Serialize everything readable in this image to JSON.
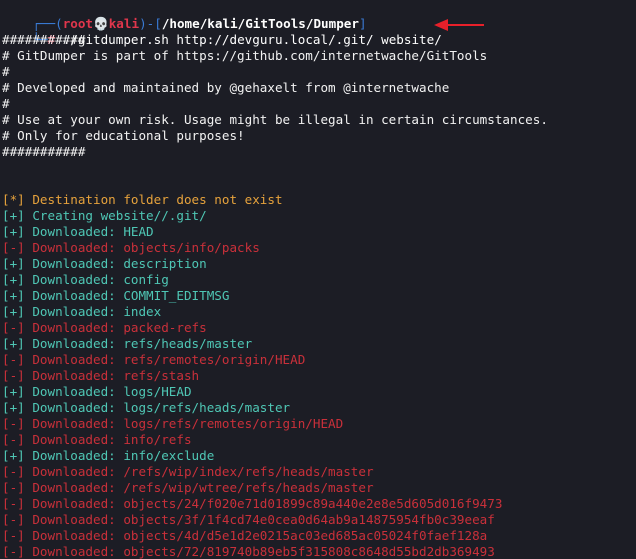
{
  "prompt": {
    "frame_top": "┌──(",
    "user": "root",
    "skull": "💀",
    "host": "kali",
    "frame_mid": ")-[",
    "path": "/home/kali/GitTools/Dumper",
    "frame_end": "]",
    "frame_bottom": "└─",
    "hash": "#",
    "command": " ./gitdumper.sh http://devguru.local/.git/ website/"
  },
  "banner": [
    "###########",
    "# GitDumper is part of https://github.com/internetwache/GitTools",
    "#",
    "# Developed and maintained by @gehaxelt from @internetwache",
    "#",
    "# Use at your own risk. Usage might be illegal in certain circumstances.",
    "# Only for educational purposes!",
    "###########"
  ],
  "output": [
    {
      "type": "info",
      "text": "[*] Destination folder does not exist"
    },
    {
      "type": "ok",
      "text": "[+] Creating website//.git/"
    },
    {
      "type": "ok",
      "text": "[+] Downloaded: HEAD"
    },
    {
      "type": "err",
      "text": "[-] Downloaded: objects/info/packs"
    },
    {
      "type": "ok",
      "text": "[+] Downloaded: description"
    },
    {
      "type": "ok",
      "text": "[+] Downloaded: config"
    },
    {
      "type": "ok",
      "text": "[+] Downloaded: COMMIT_EDITMSG"
    },
    {
      "type": "ok",
      "text": "[+] Downloaded: index"
    },
    {
      "type": "err",
      "text": "[-] Downloaded: packed-refs"
    },
    {
      "type": "ok",
      "text": "[+] Downloaded: refs/heads/master"
    },
    {
      "type": "err",
      "text": "[-] Downloaded: refs/remotes/origin/HEAD"
    },
    {
      "type": "err",
      "text": "[-] Downloaded: refs/stash"
    },
    {
      "type": "ok",
      "text": "[+] Downloaded: logs/HEAD"
    },
    {
      "type": "ok",
      "text": "[+] Downloaded: logs/refs/heads/master"
    },
    {
      "type": "err",
      "text": "[-] Downloaded: logs/refs/remotes/origin/HEAD"
    },
    {
      "type": "err",
      "text": "[-] Downloaded: info/refs"
    },
    {
      "type": "ok",
      "text": "[+] Downloaded: info/exclude"
    },
    {
      "type": "err",
      "text": "[-] Downloaded: /refs/wip/index/refs/heads/master"
    },
    {
      "type": "err",
      "text": "[-] Downloaded: /refs/wip/wtree/refs/heads/master"
    },
    {
      "type": "err",
      "text": "[-] Downloaded: objects/24/f020e71d01899c89a440e2e8e5d605d016f9473"
    },
    {
      "type": "err",
      "text": "[-] Downloaded: objects/3f/1f4cd74e0cea0d64ab9a14875954fb0c39eeaf"
    },
    {
      "type": "err",
      "text": "[-] Downloaded: objects/4d/d5e1d2e0215ac03ed685ac05024f0faef128a"
    },
    {
      "type": "err",
      "text": "[-] Downloaded: objects/72/819740b89eb5f315808c8648d55bd2db369493"
    }
  ],
  "colors": {
    "background": "#1c1d25",
    "prompt_frame": "#3a7bd5",
    "prompt_user": "#e0364c",
    "info": "#e6a23c",
    "success": "#4fc7b5",
    "error": "#c9303a",
    "annotation_arrow": "#e8202a"
  }
}
